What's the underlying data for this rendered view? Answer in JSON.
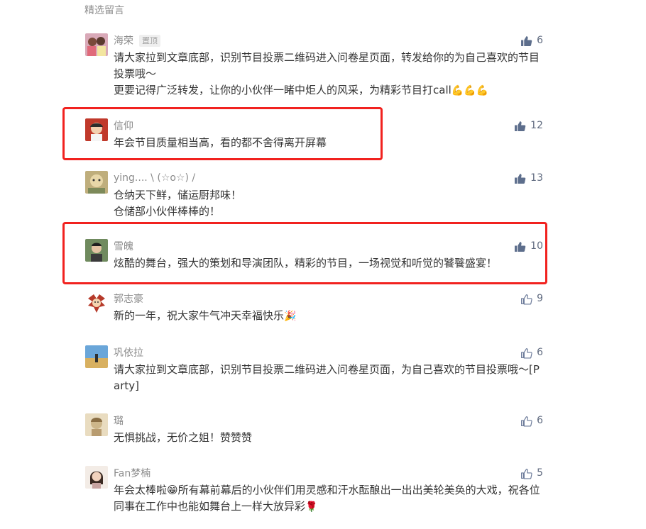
{
  "section": {
    "title": "精选留言"
  },
  "colors": {
    "highlight": "#f1221f",
    "like_filled": "#5d6e8c",
    "like_outline": "#6b7a99"
  },
  "comments": [
    {
      "nickname": "海荣",
      "badge": "置顶",
      "likes": "6",
      "liked": true,
      "lines": [
        "请大家拉到文章底部，识别节目投票二维码进入问卷星页面，转发给你的为自己喜欢的节目投票哦～",
        "更要记得广泛转发，让你的小伙伴一睹中炬人的风采，为精彩节目打call"
      ],
      "emoji": "💪💪💪"
    },
    {
      "nickname": "信仰",
      "likes": "12",
      "liked": true,
      "lines": [
        "年会节目质量相当高，看的都不舍得离开屏幕"
      ],
      "highlighted": true
    },
    {
      "nickname": "ying.... \\ (☆o☆) /",
      "likes": "13",
      "liked": true,
      "lines": [
        "仓纳天下鲜，储运厨邦味！",
        "仓储部小伙伴棒棒的！"
      ]
    },
    {
      "nickname": "雪魄",
      "likes": "10",
      "liked": true,
      "lines": [
        "炫酷的舞台，强大的策划和导演团队，精彩的节目，一场视觉和听觉的饕餮盛宴！"
      ],
      "highlighted": true
    },
    {
      "nickname": "郭志豪",
      "likes": "9",
      "liked": false,
      "lines": [
        "新的一年，祝大家牛气冲天幸福快乐"
      ],
      "emoji": "🎉"
    },
    {
      "nickname": "巩依拉",
      "likes": "6",
      "liked": false,
      "lines": [
        "请大家拉到文章底部，识别节目投票二维码进入问卷星页面，为自己喜欢的节目投票哦～[Party]"
      ]
    },
    {
      "nickname": "璐",
      "likes": "6",
      "liked": false,
      "lines": [
        "无惧挑战，无价之姐！赞赞赞"
      ]
    },
    {
      "nickname": "Fan梦楠",
      "likes": "5",
      "liked": false,
      "lines": [
        "年会太棒啦😁所有幕前幕后的小伙伴们用灵感和汗水酝酿出一出出美轮美奂的大戏，祝各位同事在工作中也能如舞台上一样大放异彩"
      ],
      "emoji": "🌹"
    }
  ]
}
